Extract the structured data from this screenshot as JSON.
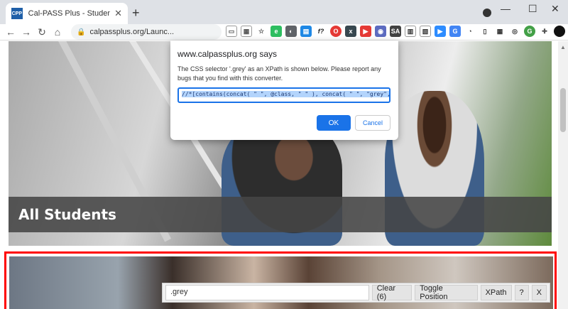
{
  "browser": {
    "tab_title": "Cal-PASS Plus - Student-Success",
    "favicon_text": "CPP",
    "url": "calpassplus.org/Launc...",
    "controls": {
      "minimize": "—",
      "maximize": "☐",
      "close": "✕"
    }
  },
  "page": {
    "hero_title": "All Students"
  },
  "dialog": {
    "title": "www.calpassplus.org says",
    "message": "The CSS selector '.grey' as an XPath is shown below.  Please report any bugs that you find with this converter.",
    "xpath_value": "//*[contains(concat( \" \", @class, \" \" ), concat( \" \", \"grey\", \" \" ))]",
    "ok_label": "OK",
    "cancel_label": "Cancel"
  },
  "converter": {
    "input_value": ".grey",
    "clear_label": "Clear (6)",
    "toggle_label": "Toggle Position",
    "xpath_label": "XPath",
    "help_label": "?",
    "close_label": "X"
  },
  "colors": {
    "accent": "#1a73e8",
    "highlight_border": "#ff0000"
  }
}
